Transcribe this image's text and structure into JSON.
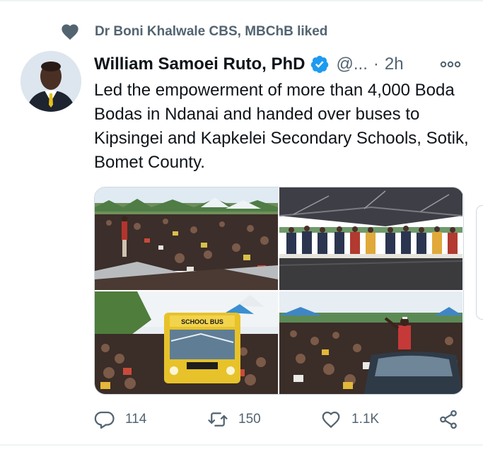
{
  "social_context": {
    "text": "Dr Boni Khalwale CBS, MBChB liked",
    "icon": "heart-icon"
  },
  "tweet": {
    "author_name": "William Samoei Ruto, PhD",
    "verified": true,
    "handle": "@...",
    "separator": "·",
    "time": "2h",
    "text": "Led the empowerment of more than 4,000 Boda Bodas in Ndanai and handed over buses to Kipsingei and Kapkelei Secondary Schools, Sotik, Bomet County.",
    "media": [
      {
        "name": "photo-crowd-speaker"
      },
      {
        "name": "photo-dignitaries-tent"
      },
      {
        "name": "photo-school-bus",
        "visible_text": "SCHOOL BUS"
      },
      {
        "name": "photo-car-crowd"
      }
    ]
  },
  "actions": {
    "reply": {
      "icon": "reply-icon",
      "count": "114"
    },
    "retweet": {
      "icon": "retweet-icon",
      "count": "150"
    },
    "like": {
      "icon": "heart-outline-icon",
      "count": "1.1K"
    },
    "share": {
      "icon": "share-icon"
    }
  },
  "colors": {
    "verified": "#1d9bf0",
    "secondary_text": "#536471",
    "primary_text": "#0f1419",
    "border": "#cfd9de"
  }
}
